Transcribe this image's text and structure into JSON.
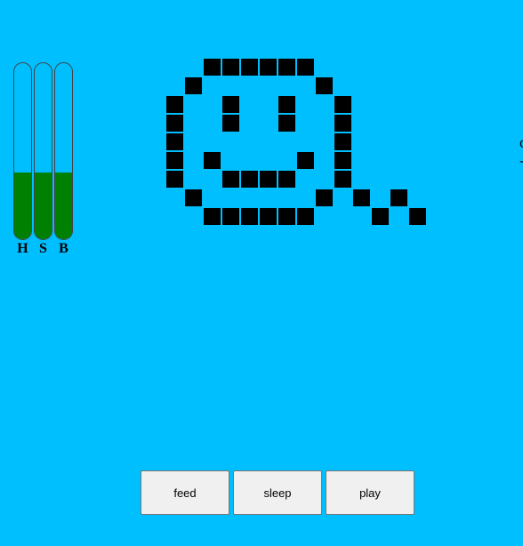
{
  "meters": [
    {
      "key": "health",
      "label": "H",
      "level": 0.38,
      "fill_color": "#008000"
    },
    {
      "key": "sleep",
      "label": "S",
      "level": 0.38,
      "fill_color": "#008000"
    },
    {
      "key": "boredom",
      "label": "B",
      "level": 0.38,
      "fill_color": "#008000"
    }
  ],
  "pet": {
    "name": "smiley-pet",
    "color": "#000000",
    "mood": "happy"
  },
  "offscreen_text": "c\n-",
  "buttons": {
    "feed_label": "feed",
    "sleep_label": "sleep",
    "play_label": "play"
  },
  "colors": {
    "background": "#00bfff",
    "button_bg": "#f0f0f0"
  }
}
